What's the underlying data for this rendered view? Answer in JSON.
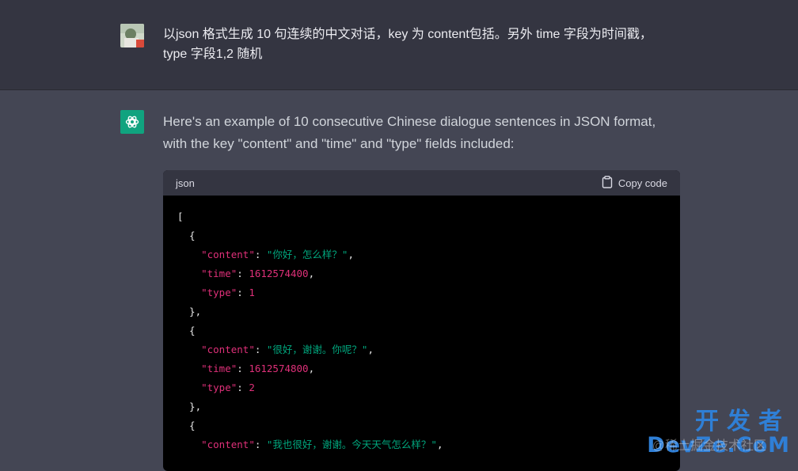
{
  "user_message": {
    "line1": "以json 格式生成 10 句连续的中文对话，key 为 content包括。另外 time 字段为时间戳，",
    "line2": "type 字段1,2 随机"
  },
  "assistant_message": {
    "line1": "Here's an example of 10 consecutive Chinese dialogue sentences in JSON format,",
    "line2": "with the key \"content\" and \"time\" and \"type\" fields included:"
  },
  "code_block": {
    "language": "json",
    "copy_label": "Copy code",
    "lines": [
      "[",
      "  {",
      "    \"content\": \"你好，怎么样？\",",
      "    \"time\": 1612574400,",
      "    \"type\": 1",
      "  },",
      "  {",
      "    \"content\": \"很好，谢谢。你呢？\",",
      "    \"time\": 1612574800,",
      "    \"type\": 2",
      "  },",
      "  {",
      "    \"content\": \"我也很好，谢谢。今天天气怎么样？\","
    ]
  },
  "watermark": {
    "top": "开发者",
    "bottom": "DevZe.CoM",
    "faint": "@稀土掘金技术社区"
  },
  "colors": {
    "user_bg": "#343541",
    "assistant_bg": "#444654",
    "code_bg": "#000000",
    "brand": "#10a37f"
  }
}
